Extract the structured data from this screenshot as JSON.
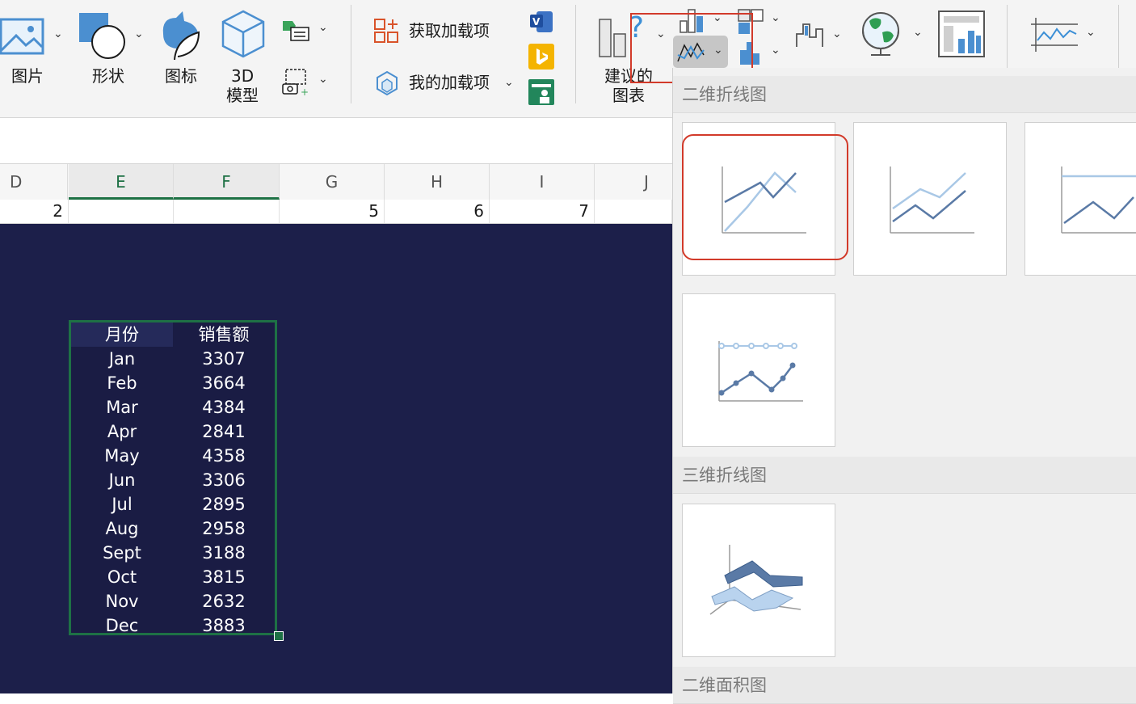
{
  "ribbon": {
    "picture_label": "图片",
    "shape_label": "形状",
    "icon_label": "图标",
    "model3d_label_1": "3D",
    "model3d_label_2": "模型",
    "get_addins_label": "获取加载项",
    "my_addins_label": "我的加载项",
    "recommended_charts_1": "建议的",
    "recommended_charts_2": "图表"
  },
  "columns": [
    "D",
    "E",
    "F",
    "G",
    "H",
    "I",
    "J"
  ],
  "row1": {
    "D": "2",
    "E": "",
    "F": "",
    "G": "5",
    "H": "6",
    "I": "7",
    "J": ""
  },
  "table": {
    "headers": [
      "月份",
      "销售额"
    ],
    "rows": [
      [
        "Jan",
        "3307"
      ],
      [
        "Feb",
        "3664"
      ],
      [
        "Mar",
        "4384"
      ],
      [
        "Apr",
        "2841"
      ],
      [
        "May",
        "4358"
      ],
      [
        "Jun",
        "3306"
      ],
      [
        "Jul",
        "2895"
      ],
      [
        "Aug",
        "2958"
      ],
      [
        "Sept",
        "3188"
      ],
      [
        "Oct",
        "3815"
      ],
      [
        "Nov",
        "2632"
      ],
      [
        "Dec",
        "3883"
      ]
    ]
  },
  "panel": {
    "section_2d_line": "二维折线图",
    "section_3d_line": "三维折线图",
    "section_2d_area": "二维面积图"
  },
  "colors": {
    "accent_green": "#1e7145",
    "highlight_red": "#d23a2a",
    "sheet_bg": "#1c1f4a",
    "line_dark": "#5a7aa6",
    "line_light": "#a9c8e6"
  }
}
